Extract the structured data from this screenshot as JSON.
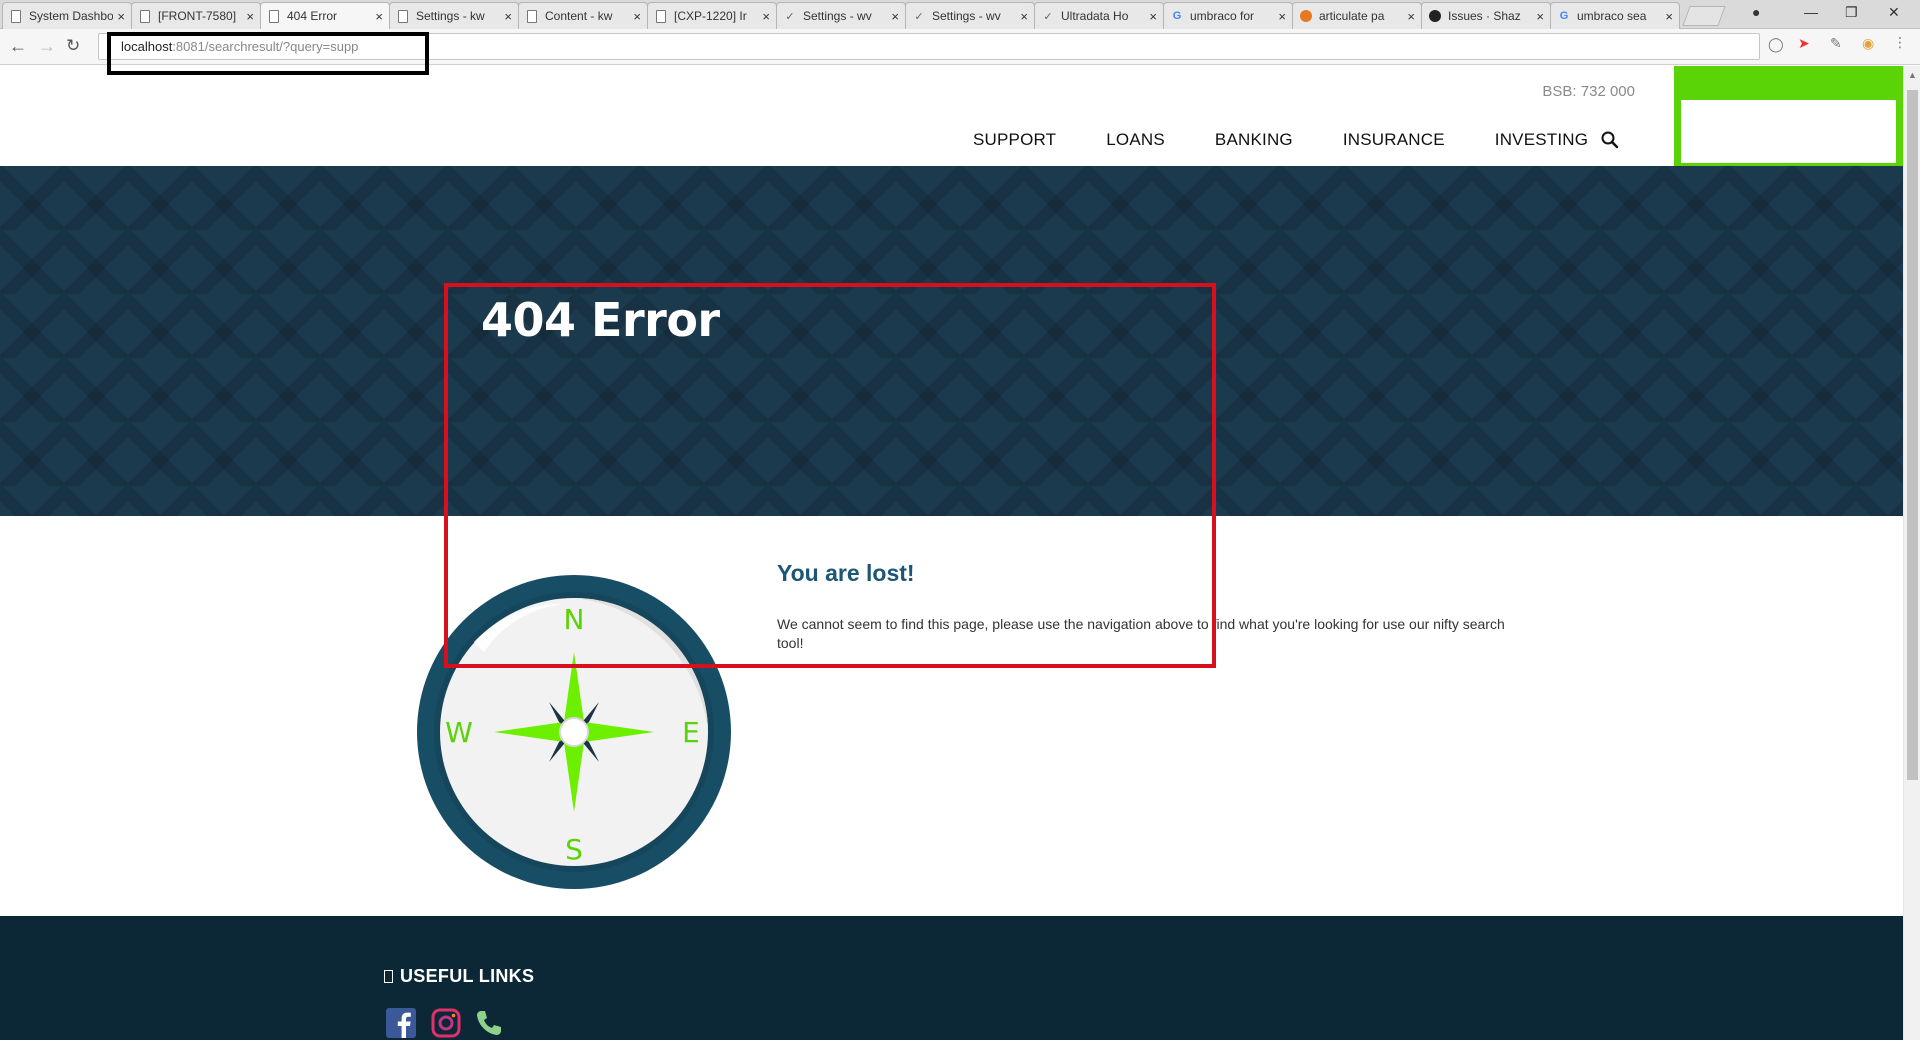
{
  "browser": {
    "tabs": [
      {
        "title": "System Dashboard",
        "icon": "doc-icon"
      },
      {
        "title": "[FRONT-7580]",
        "icon": "doc-icon"
      },
      {
        "title": "404 Error",
        "icon": "doc-icon",
        "active": true
      },
      {
        "title": "Settings - kw",
        "icon": "doc-icon"
      },
      {
        "title": "Content - kw",
        "icon": "doc-icon"
      },
      {
        "title": "[CXP-1220] Ir",
        "icon": "doc-icon"
      },
      {
        "title": "Settings - wv",
        "icon": "check-icon"
      },
      {
        "title": "Settings - wv",
        "icon": "check-icon"
      },
      {
        "title": "Ultradata Ho",
        "icon": "check-icon"
      },
      {
        "title": "umbraco for",
        "icon": "google-icon"
      },
      {
        "title": "articulate pa",
        "icon": "articulate-icon"
      },
      {
        "title": "Issues · Shaz",
        "icon": "github-icon"
      },
      {
        "title": "umbraco sea",
        "icon": "google-icon"
      }
    ],
    "close_glyph": "×",
    "url_host": "localhost",
    "url_rest": ":8081/searchresult/?query=supp"
  },
  "header": {
    "bsb": "BSB: 732 000",
    "nav": [
      "SUPPORT",
      "LOANS",
      "BANKING",
      "INSURANCE",
      "INVESTING"
    ]
  },
  "hero": {
    "title": "404 Error"
  },
  "content": {
    "heading": "You are lost!",
    "message": "We cannot seem to find this page, please use the navigation above to find what you're looking for use our nifty search tool!",
    "compass": {
      "n": "N",
      "e": "E",
      "s": "S",
      "w": "W"
    }
  },
  "footer": {
    "useful_links": "USEFUL LINKS",
    "social_icons": [
      "facebook-icon",
      "instagram-icon",
      "phone-icon"
    ]
  },
  "colors": {
    "hero_bg": "#1b3a4e",
    "footer_bg": "#0c2736",
    "accent_green": "#5bd407",
    "heading_blue": "#1c5674",
    "annotation_red": "#d8101e",
    "annotation_black": "#000000"
  }
}
